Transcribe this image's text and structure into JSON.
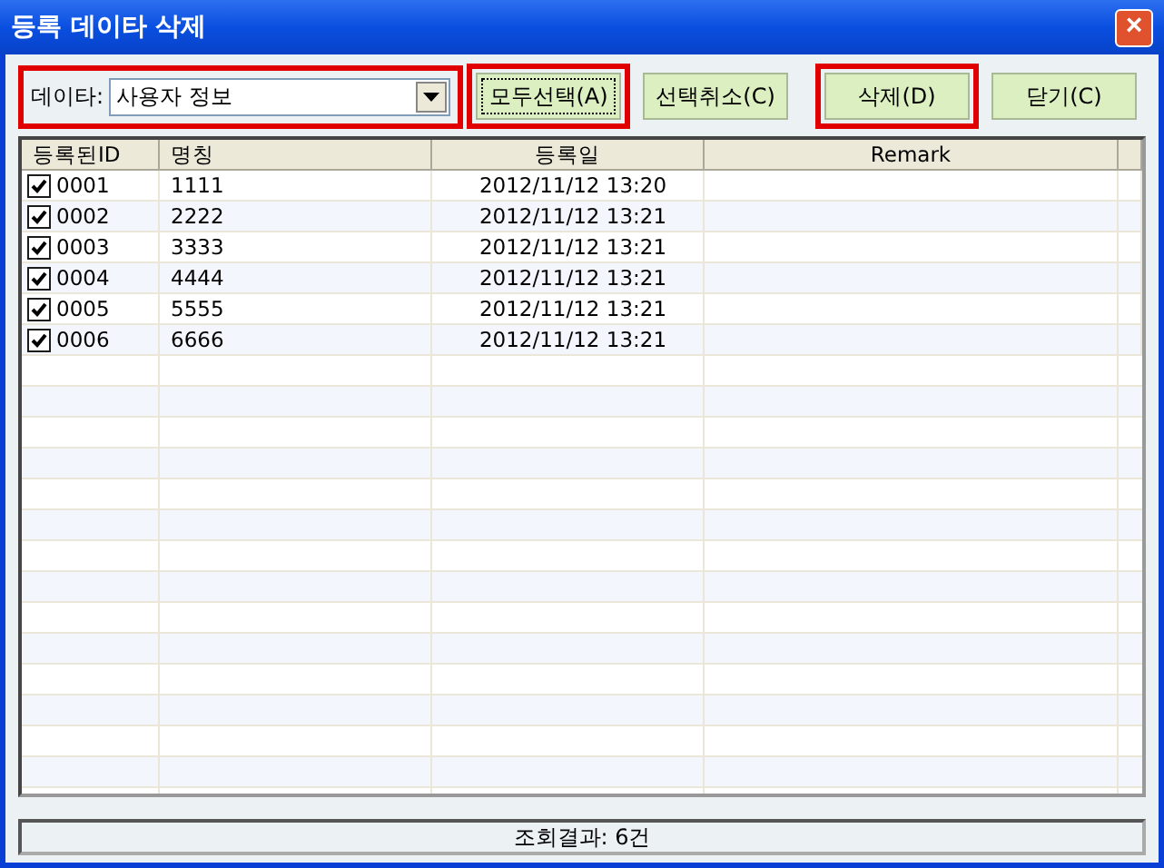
{
  "window": {
    "title": "등록 데이타 삭제",
    "close": "×"
  },
  "toolbar": {
    "data_label": "데이타:",
    "data_select": {
      "value": "사용자 정보",
      "highlighted": true
    },
    "buttons": [
      {
        "label": "모두선택(A)",
        "highlighted": true,
        "focused": true
      },
      {
        "label": "선택취소(C)",
        "highlighted": false,
        "focused": false
      },
      {
        "label": "삭제(D)",
        "highlighted": true,
        "focused": false
      },
      {
        "label": "닫기(C)",
        "highlighted": false,
        "focused": false
      }
    ]
  },
  "table": {
    "columns": [
      "등록된ID",
      "명칭",
      "등록일",
      "Remark"
    ],
    "rows": [
      {
        "checked": true,
        "id": "0001",
        "name": "1111",
        "date": "2012/11/12 13:20"
      },
      {
        "checked": true,
        "id": "0002",
        "name": "2222",
        "date": "2012/11/12 13:21"
      },
      {
        "checked": true,
        "id": "0003",
        "name": "3333",
        "date": "2012/11/12 13:21"
      },
      {
        "checked": true,
        "id": "0004",
        "name": "4444",
        "date": "2012/11/12 13:21"
      },
      {
        "checked": true,
        "id": "0005",
        "name": "5555",
        "date": "2012/11/12 13:21"
      },
      {
        "checked": true,
        "id": "0006",
        "name": "6666",
        "date": "2012/11/12 13:21"
      }
    ]
  },
  "status_bar": "조회결과: 6건"
}
